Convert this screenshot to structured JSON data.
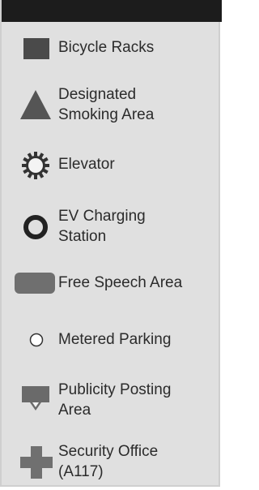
{
  "legend": {
    "items": [
      {
        "label": "Bicycle Racks",
        "icon": "square-icon",
        "color": "#4a4a4a"
      },
      {
        "label": "Designated\nSmoking Area",
        "icon": "triangle-icon",
        "color": "#555555"
      },
      {
        "label": "Elevator",
        "icon": "gear-icon",
        "color": "#333333"
      },
      {
        "label": "EV Charging\nStation",
        "icon": "ring-icon",
        "color": "#222222"
      },
      {
        "label": "Free Speech Area",
        "icon": "rounded-rectangle-icon",
        "color": "#6f6f6f"
      },
      {
        "label": "Metered Parking",
        "icon": "circle-icon",
        "color": "#ffffff"
      },
      {
        "label": "Publicity Posting\nArea",
        "icon": "posting-arrow-icon",
        "color": "#6a6a6a"
      },
      {
        "label": "Security Office\n(A117)",
        "icon": "cross-icon",
        "color": "#707070"
      }
    ]
  }
}
